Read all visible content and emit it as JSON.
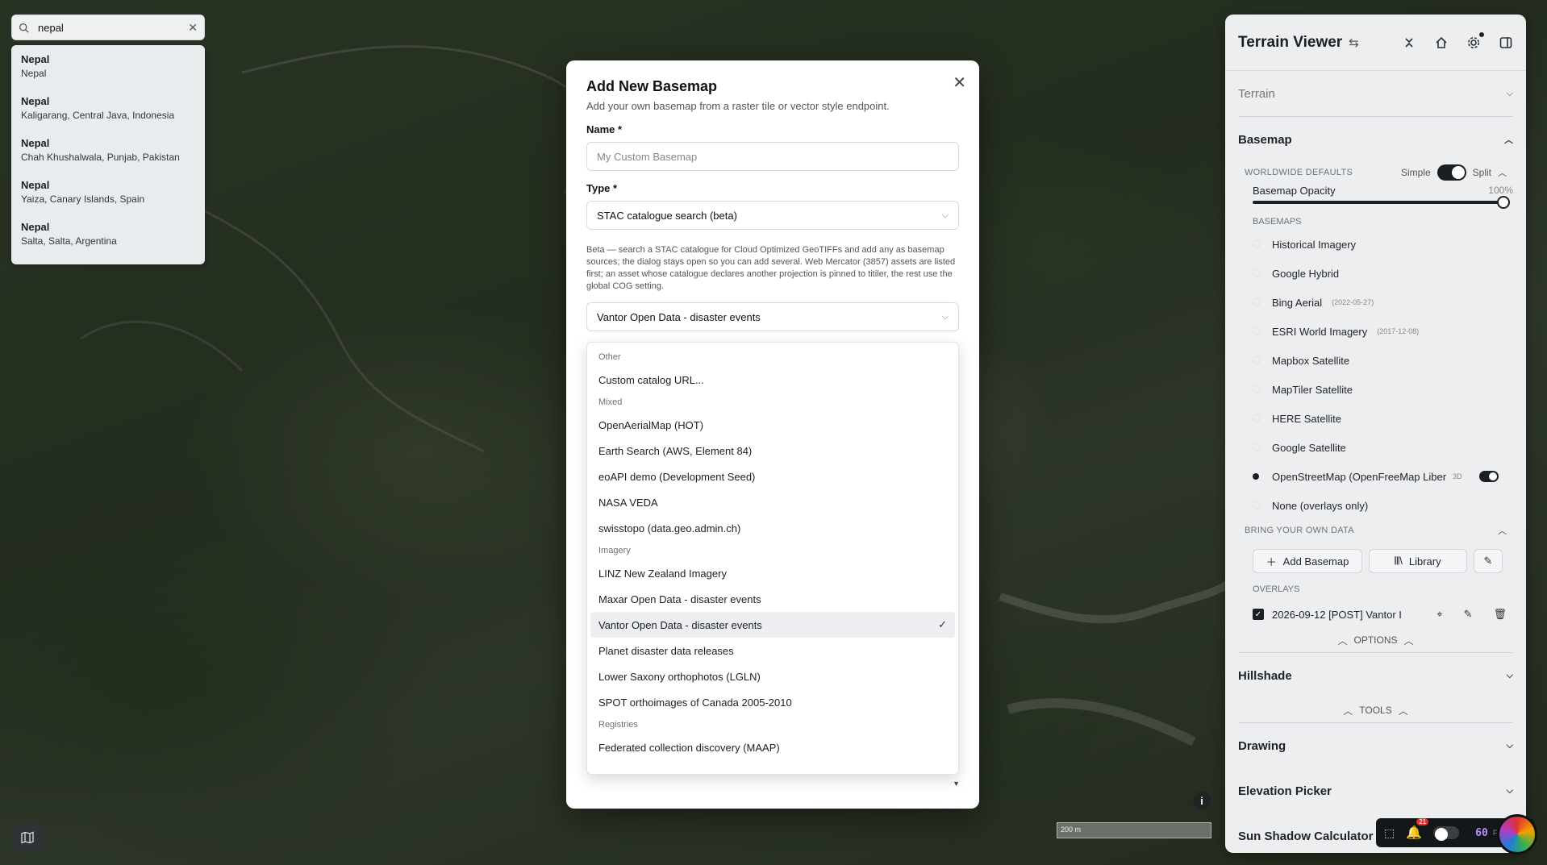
{
  "search": {
    "value": "nepal",
    "results": [
      {
        "title": "Nepal",
        "subtitle": "Nepal"
      },
      {
        "title": "Nepal",
        "subtitle": "Kaligarang, Central Java, Indonesia"
      },
      {
        "title": "Nepal",
        "subtitle": "Chah Khushalwala, Punjab, Pakistan"
      },
      {
        "title": "Nepal",
        "subtitle": "Yaiza, Canary Islands, Spain"
      },
      {
        "title": "Nepal",
        "subtitle": "Salta, Salta, Argentina"
      }
    ]
  },
  "modal": {
    "title": "Add New Basemap",
    "subtitle": "Add your own basemap from a raster tile or vector style endpoint.",
    "name_label": "Name *",
    "name_placeholder": "My Custom Basemap",
    "type_label": "Type *",
    "type_value": "STAC catalogue search (beta)",
    "beta_note": "Beta — search a STAC catalogue for Cloud Optimized GeoTIFFs and add any as basemap sources; the dialog stays open so you can add several. Web Mercator (3857) assets are listed first; an asset whose catalogue declares another projection is pinned to titiler, the rest use the global COG setting.",
    "catalog_value": "Vantor Open Data - disaster events",
    "dropdown": {
      "groups": [
        {
          "label": "Other",
          "items": [
            "Custom catalog URL..."
          ]
        },
        {
          "label": "Mixed",
          "items": [
            "OpenAerialMap (HOT)",
            "Earth Search (AWS, Element 84)",
            "eoAPI demo (Development Seed)",
            "NASA VEDA",
            "swisstopo (data.geo.admin.ch)"
          ]
        },
        {
          "label": "Imagery",
          "items": [
            "LINZ New Zealand Imagery",
            "Maxar Open Data - disaster events",
            "Vantor Open Data - disaster events",
            "Planet disaster data releases",
            "Lower Saxony orthophotos (LGLN)",
            "SPOT orthoimages of Canada 2005-2010"
          ]
        },
        {
          "label": "Registries",
          "items": [
            "Federated collection discovery (MAAP)"
          ]
        }
      ],
      "selected": "Vantor Open Data - disaster events"
    }
  },
  "panel": {
    "title": "Terrain Viewer",
    "terrain_label": "Terrain",
    "basemap_label": "Basemap",
    "worldwide_defaults": "WORLDWIDE DEFAULTS",
    "simple_label": "Simple",
    "split_label": "Split",
    "opacity_label": "Basemap Opacity",
    "opacity_value": "100%",
    "opacity_fraction": 1.0,
    "basemaps_label": "BASEMAPS",
    "basemaps": [
      {
        "name": "Historical Imagery",
        "date": "",
        "selected": false
      },
      {
        "name": "Google Hybrid",
        "date": "",
        "selected": false
      },
      {
        "name": "Bing Aerial",
        "date": "(2022-05-27)",
        "selected": false
      },
      {
        "name": "ESRI World Imagery",
        "date": "(2017-12-08)",
        "selected": false
      },
      {
        "name": "Mapbox Satellite",
        "date": "",
        "selected": false
      },
      {
        "name": "MapTiler Satellite",
        "date": "",
        "selected": false
      },
      {
        "name": "HERE Satellite",
        "date": "",
        "selected": false
      },
      {
        "name": "Google Satellite",
        "date": "",
        "selected": false
      },
      {
        "name": "OpenStreetMap (OpenFreeMap Liber",
        "date": "",
        "selected": true,
        "tag": "3D"
      },
      {
        "name": "None (overlays only)",
        "date": "",
        "selected": false
      }
    ],
    "byod_label": "BRING YOUR OWN DATA",
    "add_basemap_label": "Add Basemap",
    "library_label": "Library",
    "overlays_label": "OVERLAYS",
    "overlay_item": "2026-09-12 [POST] Vantor I",
    "options_label": "OPTIONS",
    "hillshade_label": "Hillshade",
    "tools_label": "TOOLS",
    "drawing_label": "Drawing",
    "elevation_label": "Elevation Picker",
    "sun_label": "Sun Shadow Calculator"
  },
  "map": {
    "scale_label": "200 m",
    "notification_count": "21",
    "fps_value": "60",
    "fps_label": "FPS"
  },
  "colors": {
    "accent": "#1b1f23",
    "selected_row": "#eceef1",
    "fps": "#b98cff",
    "badge": "#e03131"
  }
}
